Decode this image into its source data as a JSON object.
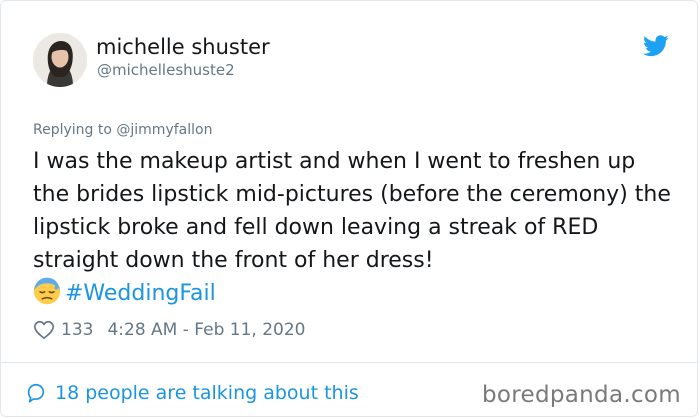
{
  "author": {
    "name": "michelle shuster",
    "handle": "@michelleshuste2"
  },
  "reply": {
    "prefix": "Replying to ",
    "mention": "@jimmyfallon"
  },
  "tweet": {
    "text": "I was the makeup artist and when I went to freshen up the brides lipstick mid-pictures (before the ceremony) the lipstick broke and fell down leaving a streak of RED straight down the front of her dress!",
    "hashtag": "#WeddingFail"
  },
  "stats": {
    "likes": "133",
    "timestamp": "4:28 AM - Feb 11, 2020"
  },
  "footer": {
    "talking": "18 people are talking about this",
    "watermark": "boredpanda.com"
  },
  "colors": {
    "accent": "#1b95e0",
    "muted": "#657786",
    "text": "#14171a"
  },
  "icons": {
    "brand": "twitter-bird-icon",
    "like": "heart-outline-icon",
    "reply": "speech-bubble-icon",
    "emoji": "cold-sweat-face-emoji"
  }
}
